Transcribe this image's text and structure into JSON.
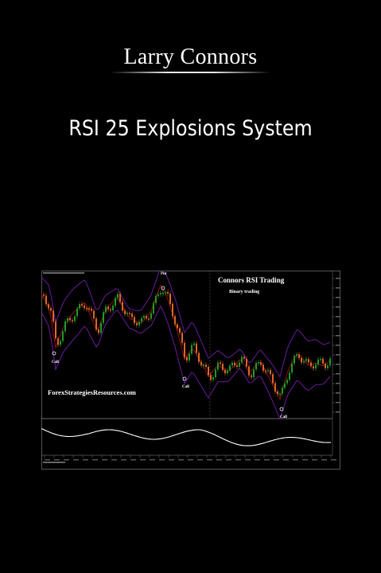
{
  "cover": {
    "author": "Larry Connors",
    "title": "RSI 25 Explosions System"
  },
  "chart": {
    "title": "Connors RSI Trading",
    "subtitle": "Binary trading",
    "brand": "ForexStrategiesResources.com",
    "signals": [
      {
        "label": "Call"
      },
      {
        "label": "Put"
      },
      {
        "label": "Call"
      },
      {
        "label": "Call"
      }
    ]
  },
  "colors": {
    "background": "#000000",
    "bull_candle": "#1f9a2a",
    "bear_candle": "#e0652a",
    "band": "#6a1a9a",
    "mid_line": "#b01010",
    "oscillator": "#ffffff"
  }
}
